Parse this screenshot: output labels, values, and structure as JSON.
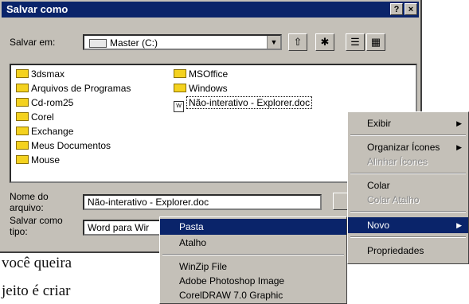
{
  "dialog": {
    "title": "Salvar como",
    "help_label": "?",
    "close_label": "×"
  },
  "save_in": {
    "label": "Salvar em:",
    "label_mnemonic": "S",
    "value": "Master (C:)"
  },
  "files": {
    "folders_col1": [
      "3dsmax",
      "Arquivos de Programas",
      "Cd-rom25",
      "Corel",
      "Exchange",
      "Meus Documentos",
      "Mouse"
    ],
    "folders_col2": [
      "MSOffice",
      "Windows"
    ],
    "document": "Não-interativo - Explorer.doc"
  },
  "filename": {
    "label_line1": "Nome do",
    "label_line2": "arquivo:",
    "value": "Não-interativo - Explorer.doc"
  },
  "filetype": {
    "label_line1": "Salvar como",
    "label_line2": "tipo:",
    "value": "Word para Wir"
  },
  "context_menu": {
    "items": [
      "Exibir",
      "Organizar Ícones",
      "Alinhar Ícones",
      "Colar",
      "Colar Atalho",
      "Novo",
      "Propriedades"
    ]
  },
  "new_submenu": {
    "items": [
      "Pasta",
      "Atalho",
      "WinZip File",
      "Adobe Photoshop Image",
      "CorelDRAW 7.0 Graphic"
    ]
  },
  "background_text": {
    "line1": "você queira",
    "line2": "jeito é criar"
  },
  "colors": {
    "title_bar": "#0a246a",
    "dialog_face": "#c4c0b8",
    "highlight": "#0a246a",
    "folder": "#f4d21f"
  }
}
